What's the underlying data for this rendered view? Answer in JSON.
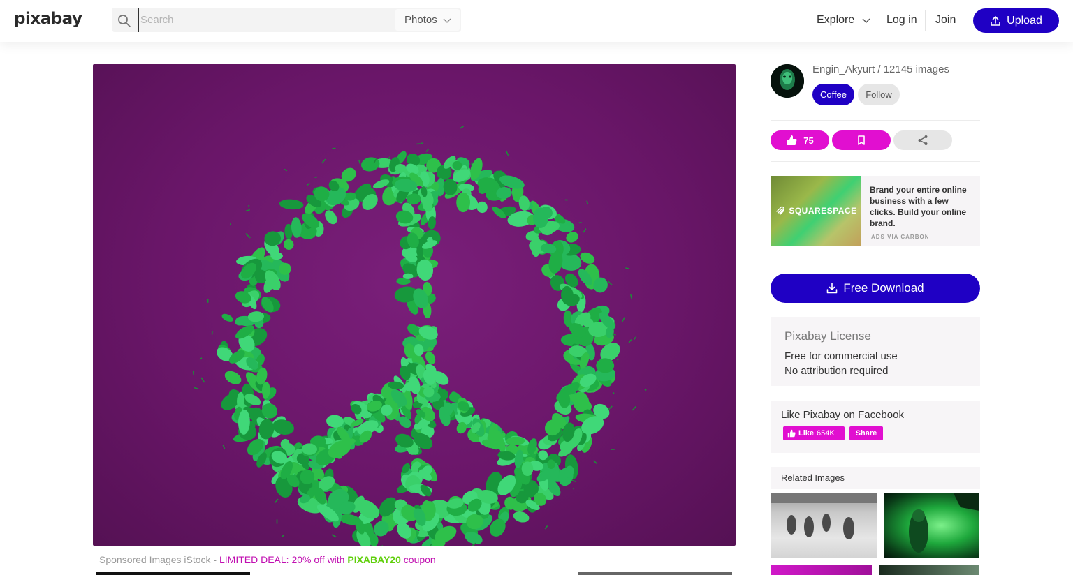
{
  "header": {
    "logo_text": "pixabay",
    "search": {
      "placeholder": "Search",
      "value": "",
      "type_label": "Photos"
    },
    "nav": {
      "explore": "Explore",
      "login": "Log in",
      "join": "Join",
      "upload": "Upload"
    }
  },
  "author": {
    "name_and_count": "Engin_Akyurt / 12145 images",
    "coffee_label": "Coffee",
    "follow_label": "Follow"
  },
  "actions": {
    "likes": "75"
  },
  "ad": {
    "brand": "SQUARESPACE",
    "text": "Brand your entire online business with a few clicks. Build your online brand.",
    "via": "ADS VIA CARBON"
  },
  "download": {
    "label": "Free Download"
  },
  "license": {
    "link": "Pixabay License",
    "line1": "Free for commercial use",
    "line2": "No attribution required"
  },
  "facebook": {
    "title": "Like Pixabay on Facebook",
    "like_label": "Like",
    "like_count": "654K",
    "share_label": "Share"
  },
  "related": {
    "heading": "Related Images"
  },
  "sponsored": {
    "prefix": "Sponsored Images iStock - ",
    "deal": "LIMITED DEAL: 20% off with ",
    "code": "PIXABAY20",
    "suffix": " coupon"
  },
  "colors": {
    "accent": "#1f00c4",
    "pink": "#e10fd0",
    "photo_bg": "#6a1669",
    "leaf_green": "#2ec04a"
  }
}
